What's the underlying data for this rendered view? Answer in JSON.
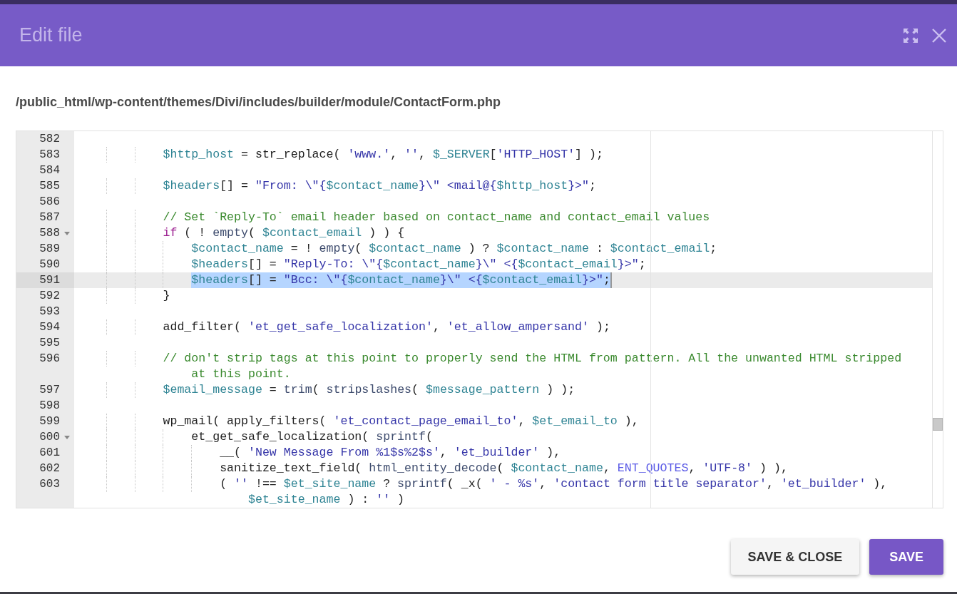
{
  "dialog": {
    "title": "Edit file",
    "file_path": "/public_html/wp-content/themes/Divi/includes/builder/module/ContactForm.php"
  },
  "editor": {
    "lines": [
      {
        "kind": "line",
        "number": "582",
        "fold": false,
        "active": false,
        "selected": false
      },
      {
        "kind": "line",
        "number": "583",
        "fold": false,
        "active": false,
        "selected": false,
        "segments": [
          {
            "kind": "var",
            "text": "            $http_host"
          },
          {
            "kind": "plain",
            "text": " = str_replace( "
          },
          {
            "kind": "string",
            "text": "'www.'"
          },
          {
            "kind": "plain",
            "text": ", "
          },
          {
            "kind": "string",
            "text": "''"
          },
          {
            "kind": "plain",
            "text": ", "
          },
          {
            "kind": "var",
            "text": "$_SERVER"
          },
          {
            "kind": "plain",
            "text": "["
          },
          {
            "kind": "string",
            "text": "'HTTP_HOST'"
          },
          {
            "kind": "plain",
            "text": "] );"
          }
        ]
      },
      {
        "kind": "line",
        "number": "584",
        "fold": false,
        "active": false,
        "selected": false
      },
      {
        "kind": "line",
        "number": "585",
        "fold": false,
        "active": false,
        "selected": false,
        "segments": [
          {
            "kind": "var",
            "text": "            $headers"
          },
          {
            "kind": "plain",
            "text": "[] = "
          },
          {
            "kind": "string",
            "text": "\"From: \\\"{"
          },
          {
            "kind": "var",
            "text": "$contact_name"
          },
          {
            "kind": "string",
            "text": "}\\\" <mail@{"
          },
          {
            "kind": "var",
            "text": "$http_host"
          },
          {
            "kind": "string",
            "text": "}>\""
          },
          {
            "kind": "plain",
            "text": ";"
          }
        ]
      },
      {
        "kind": "line",
        "number": "586",
        "fold": false,
        "active": false,
        "selected": false
      },
      {
        "kind": "line",
        "number": "587",
        "fold": false,
        "active": false,
        "selected": false,
        "segments": [
          {
            "kind": "comment",
            "text": "            // Set `Reply-To` email header based on contact_name and contact_email values"
          }
        ]
      },
      {
        "kind": "line",
        "number": "588",
        "fold": true,
        "active": false,
        "selected": false,
        "segments": [
          {
            "kind": "keyword",
            "text": "            if"
          },
          {
            "kind": "plain",
            "text": " ( ! "
          },
          {
            "kind": "builtin",
            "text": "empty"
          },
          {
            "kind": "plain",
            "text": "( "
          },
          {
            "kind": "var",
            "text": "$contact_email"
          },
          {
            "kind": "plain",
            "text": " ) ) {"
          }
        ]
      },
      {
        "kind": "line",
        "number": "589",
        "fold": false,
        "active": false,
        "selected": false,
        "segments": [
          {
            "kind": "var",
            "text": "                $contact_name"
          },
          {
            "kind": "plain",
            "text": " = ! "
          },
          {
            "kind": "builtin",
            "text": "empty"
          },
          {
            "kind": "plain",
            "text": "( "
          },
          {
            "kind": "var",
            "text": "$contact_name"
          },
          {
            "kind": "plain",
            "text": " ) ? "
          },
          {
            "kind": "var",
            "text": "$contact_name"
          },
          {
            "kind": "plain",
            "text": " : "
          },
          {
            "kind": "var",
            "text": "$contact_email"
          },
          {
            "kind": "plain",
            "text": ";"
          }
        ]
      },
      {
        "kind": "line",
        "number": "590",
        "fold": false,
        "active": false,
        "selected": false,
        "segments": [
          {
            "kind": "var",
            "text": "                $headers"
          },
          {
            "kind": "plain",
            "text": "[] = "
          },
          {
            "kind": "string",
            "text": "\"Reply-To: \\\"{"
          },
          {
            "kind": "var",
            "text": "$contact_name"
          },
          {
            "kind": "string",
            "text": "}\\\" <{"
          },
          {
            "kind": "var",
            "text": "$contact_email"
          },
          {
            "kind": "string",
            "text": "}>\""
          },
          {
            "kind": "plain",
            "text": ";"
          }
        ]
      },
      {
        "kind": "line",
        "number": "591",
        "fold": false,
        "active": true,
        "selected": true,
        "segments": [
          {
            "kind": "var",
            "text": "                $headers"
          },
          {
            "kind": "plain",
            "text": "[] = "
          },
          {
            "kind": "string",
            "text": "\"Bcc: \\\"{"
          },
          {
            "kind": "var",
            "text": "$contact_name"
          },
          {
            "kind": "string",
            "text": "}\\\" <{"
          },
          {
            "kind": "var",
            "text": "$contact_email"
          },
          {
            "kind": "string",
            "text": "}>\""
          },
          {
            "kind": "plain",
            "text": ";"
          }
        ]
      },
      {
        "kind": "line",
        "number": "592",
        "fold": false,
        "active": false,
        "selected": false,
        "segments": [
          {
            "kind": "plain",
            "text": "            }"
          }
        ]
      },
      {
        "kind": "line",
        "number": "593",
        "fold": false,
        "active": false,
        "selected": false
      },
      {
        "kind": "line",
        "number": "594",
        "fold": false,
        "active": false,
        "selected": false,
        "segments": [
          {
            "kind": "plain",
            "text": "            add_filter( "
          },
          {
            "kind": "string",
            "text": "'et_get_safe_localization'"
          },
          {
            "kind": "plain",
            "text": ", "
          },
          {
            "kind": "string",
            "text": "'et_allow_ampersand'"
          },
          {
            "kind": "plain",
            "text": " );"
          }
        ]
      },
      {
        "kind": "line",
        "number": "595",
        "fold": false,
        "active": false,
        "selected": false
      },
      {
        "kind": "line",
        "number": "596",
        "fold": false,
        "active": false,
        "selected": false,
        "segments": [
          {
            "kind": "comment",
            "text": "            // don't strip tags at this point to properly send the HTML from pattern. All the unwanted HTML stripped"
          }
        ]
      },
      {
        "kind": "wrap",
        "segments": [
          {
            "kind": "comment",
            "text": "                at this point."
          }
        ]
      },
      {
        "kind": "line",
        "number": "597",
        "fold": false,
        "active": false,
        "selected": false,
        "segments": [
          {
            "kind": "var",
            "text": "            $email_message"
          },
          {
            "kind": "plain",
            "text": " = "
          },
          {
            "kind": "builtin",
            "text": "trim"
          },
          {
            "kind": "plain",
            "text": "( "
          },
          {
            "kind": "builtin",
            "text": "stripslashes"
          },
          {
            "kind": "plain",
            "text": "( "
          },
          {
            "kind": "var",
            "text": "$message_pattern"
          },
          {
            "kind": "plain",
            "text": " ) );"
          }
        ]
      },
      {
        "kind": "line",
        "number": "598",
        "fold": false,
        "active": false,
        "selected": false
      },
      {
        "kind": "line",
        "number": "599",
        "fold": false,
        "active": false,
        "selected": false,
        "segments": [
          {
            "kind": "plain",
            "text": "            wp_mail( apply_filters( "
          },
          {
            "kind": "string",
            "text": "'et_contact_page_email_to'"
          },
          {
            "kind": "plain",
            "text": ", "
          },
          {
            "kind": "var",
            "text": "$et_email_to"
          },
          {
            "kind": "plain",
            "text": " ),"
          }
        ]
      },
      {
        "kind": "line",
        "number": "600",
        "fold": true,
        "active": false,
        "selected": false,
        "segments": [
          {
            "kind": "plain",
            "text": "                et_get_safe_localization( "
          },
          {
            "kind": "builtin",
            "text": "sprintf"
          },
          {
            "kind": "plain",
            "text": "("
          }
        ]
      },
      {
        "kind": "line",
        "number": "601",
        "fold": false,
        "active": false,
        "selected": false,
        "segments": [
          {
            "kind": "plain",
            "text": "                    __( "
          },
          {
            "kind": "string",
            "text": "'New Message From %1$s%2$s'"
          },
          {
            "kind": "plain",
            "text": ", "
          },
          {
            "kind": "string",
            "text": "'et_builder'"
          },
          {
            "kind": "plain",
            "text": " ),"
          }
        ]
      },
      {
        "kind": "line",
        "number": "602",
        "fold": false,
        "active": false,
        "selected": false,
        "segments": [
          {
            "kind": "plain",
            "text": "                    sanitize_text_field( "
          },
          {
            "kind": "builtin",
            "text": "html_entity_decode"
          },
          {
            "kind": "plain",
            "text": "( "
          },
          {
            "kind": "var",
            "text": "$contact_name"
          },
          {
            "kind": "plain",
            "text": ", "
          },
          {
            "kind": "constant",
            "text": "ENT_QUOTES"
          },
          {
            "kind": "plain",
            "text": ", "
          },
          {
            "kind": "string",
            "text": "'UTF-8'"
          },
          {
            "kind": "plain",
            "text": " ) ),"
          }
        ]
      },
      {
        "kind": "line",
        "number": "603",
        "fold": false,
        "active": false,
        "selected": false,
        "segments": [
          {
            "kind": "plain",
            "text": "                    ( "
          },
          {
            "kind": "string",
            "text": "''"
          },
          {
            "kind": "plain",
            "text": " !== "
          },
          {
            "kind": "var",
            "text": "$et_site_name"
          },
          {
            "kind": "plain",
            "text": " ? "
          },
          {
            "kind": "builtin",
            "text": "sprintf"
          },
          {
            "kind": "plain",
            "text": "( _x( "
          },
          {
            "kind": "string",
            "text": "' - %s'"
          },
          {
            "kind": "plain",
            "text": ", "
          },
          {
            "kind": "string",
            "text": "'contact form title separator'"
          },
          {
            "kind": "plain",
            "text": ", "
          },
          {
            "kind": "string",
            "text": "'et_builder'"
          },
          {
            "kind": "plain",
            "text": " ),"
          }
        ]
      },
      {
        "kind": "wrap",
        "segments": [
          {
            "kind": "var",
            "text": "                        $et_site_name"
          },
          {
            "kind": "plain",
            "text": " ) : "
          },
          {
            "kind": "string",
            "text": "''"
          },
          {
            "kind": "plain",
            "text": " )"
          }
        ]
      }
    ]
  },
  "buttons": [
    {
      "label": "SAVE & CLOSE",
      "kind": "secondary"
    },
    {
      "label": "SAVE",
      "kind": "primary"
    }
  ]
}
